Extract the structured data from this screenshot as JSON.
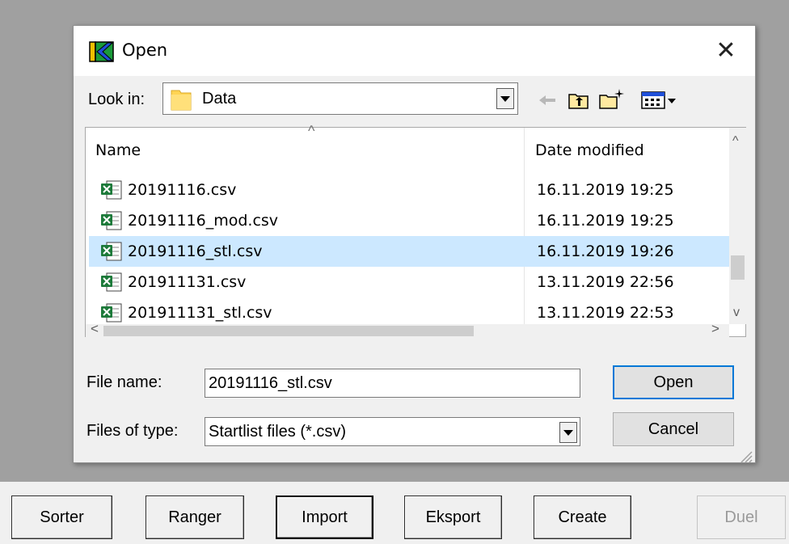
{
  "dialog": {
    "title": "Open",
    "close_glyph": "✕",
    "look_in_label": "Look in:",
    "look_in_value": "Data",
    "column_name": "Name",
    "column_date": "Date modified",
    "files": [
      {
        "name": "20191116.csv",
        "date": "16.11.2019 19:25",
        "selected": false
      },
      {
        "name": "20191116_mod.csv",
        "date": "16.11.2019 19:25",
        "selected": false
      },
      {
        "name": "20191116_stl.csv",
        "date": "16.11.2019 19:26",
        "selected": true
      },
      {
        "name": "201911131.csv",
        "date": "13.11.2019 22:56",
        "selected": false
      },
      {
        "name": "201911131_stl.csv",
        "date": "13.11.2019 22:53",
        "selected": false
      }
    ],
    "file_name_label": "File name:",
    "file_name_value": "20191116_stl.csv",
    "file_type_label": "Files of type:",
    "file_type_value": "Startlist files (*.csv)",
    "open_label": "Open",
    "cancel_label": "Cancel",
    "scroll_up_glyph": "^",
    "scroll_down_glyph": "v",
    "scroll_left_glyph": "<",
    "scroll_right_glyph": ">",
    "sort_glyph": "^"
  },
  "bottom_bar": {
    "sorter_label": "Sorter",
    "ranger_label": "Ranger",
    "import_label": "Import",
    "eksport_label": "Eksport",
    "create_label": "Create",
    "duel_label": "Duel"
  },
  "colors": {
    "selection": "#cce8ff",
    "accent": "#0078d7",
    "backdrop": "#a0a0a0",
    "excel_green": "#1d7a3a"
  }
}
